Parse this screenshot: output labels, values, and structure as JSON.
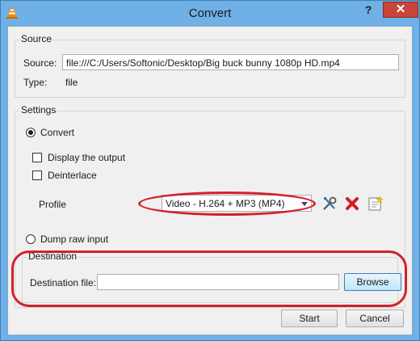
{
  "window": {
    "title": "Convert",
    "help_label": "?",
    "close_label": "✕"
  },
  "source": {
    "group_title": "Source",
    "source_label": "Source:",
    "source_value": "file:///C:/Users/Softonic/Desktop/Big buck bunny 1080p HD.mp4",
    "type_label": "Type:",
    "type_value": "file"
  },
  "settings": {
    "group_title": "Settings",
    "convert_label": "Convert",
    "display_output_label": "Display the output",
    "deinterlace_label": "Deinterlace",
    "profile_label": "Profile",
    "profile_value": "Video - H.264 + MP3 (MP4)",
    "dump_raw_label": "Dump raw input",
    "icons": [
      "edit-profile-icon",
      "delete-profile-icon",
      "new-profile-icon"
    ]
  },
  "destination": {
    "group_title": "Destination",
    "file_label": "Destination file:",
    "file_value": "",
    "browse_label": "Browse"
  },
  "footer": {
    "start_label": "Start",
    "cancel_label": "Cancel"
  },
  "colors": {
    "titlebar": "#6fb0e6",
    "close": "#c9443a",
    "annotation": "#d4202b"
  }
}
